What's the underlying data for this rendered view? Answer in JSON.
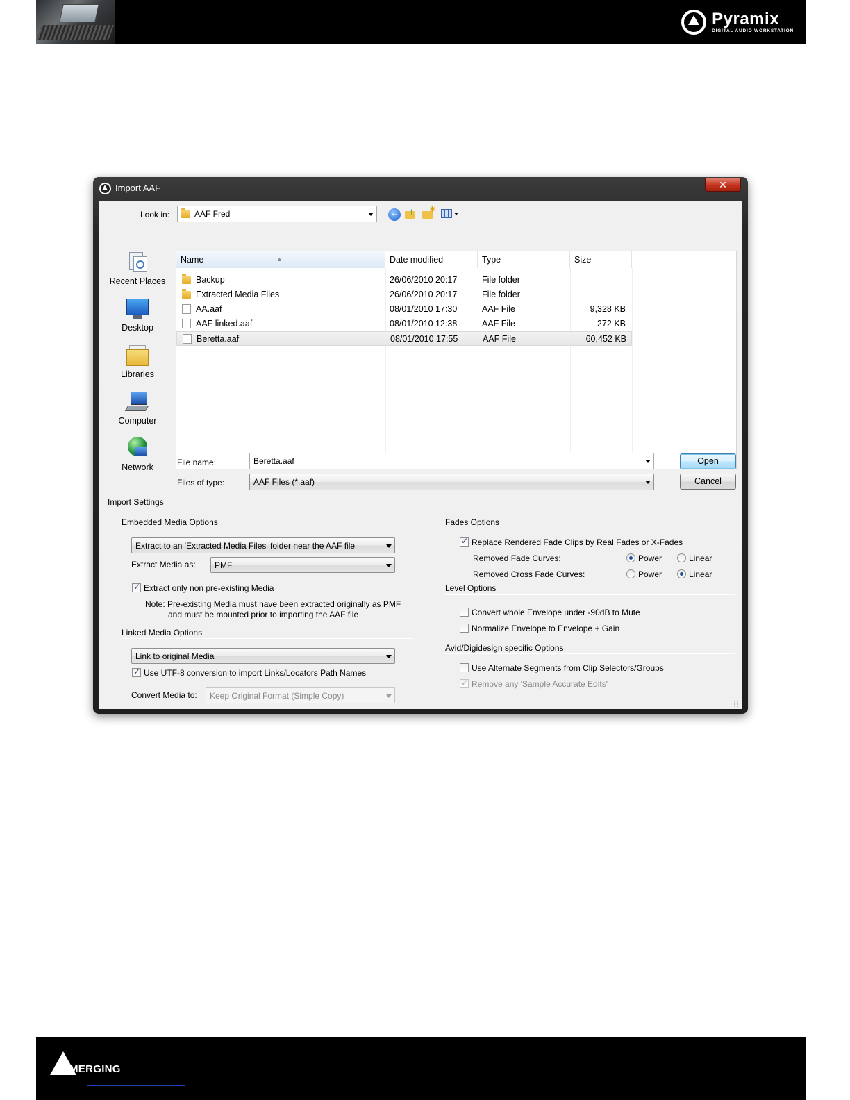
{
  "header": {
    "brand_name": "Pyramix",
    "brand_tagline": "DIGITAL AUDIO WORKSTATION"
  },
  "footer": {
    "company": "MERGING"
  },
  "dialog": {
    "title": "Import AAF",
    "close_label": "✕",
    "look_in_label": "Look in:",
    "look_in_value": "AAF Fred",
    "places": [
      "Recent Places",
      "Desktop",
      "Libraries",
      "Computer",
      "Network"
    ],
    "columns": [
      "Name",
      "Date modified",
      "Type",
      "Size"
    ],
    "files": [
      {
        "name": "Backup",
        "date": "26/06/2010 20:17",
        "type": "File folder",
        "size": "",
        "kind": "folder"
      },
      {
        "name": "Extracted Media Files",
        "date": "26/06/2010 20:17",
        "type": "File folder",
        "size": "",
        "kind": "folder"
      },
      {
        "name": "AA.aaf",
        "date": "08/01/2010 17:30",
        "type": "AAF File",
        "size": "9,328 KB",
        "kind": "file"
      },
      {
        "name": "AAF linked.aaf",
        "date": "08/01/2010 12:38",
        "type": "AAF File",
        "size": "272 KB",
        "kind": "file"
      },
      {
        "name": "Beretta.aaf",
        "date": "08/01/2010 17:55",
        "type": "AAF File",
        "size": "60,452 KB",
        "kind": "file",
        "selected": true
      }
    ],
    "file_name_label": "File name:",
    "file_name_value": "Beretta.aaf",
    "files_of_type_label": "Files of type:",
    "files_of_type_value": "AAF Files (*.aaf)",
    "open_label": "Open",
    "cancel_label": "Cancel"
  },
  "settings": {
    "title": "Import Settings",
    "embedded": {
      "title": "Embedded Media Options",
      "extract_mode": "Extract to an 'Extracted Media Files' folder near the AAF file",
      "extract_as_label": "Extract Media as:",
      "extract_as_value": "PMF",
      "only_non_existing_label": "Extract only non pre-existing Media",
      "only_non_existing_checked": true,
      "note_line1": "Note: Pre-existing Media must have been extracted originally as PMF",
      "note_line2": "and must be mounted prior to importing the AAF file"
    },
    "linked": {
      "title": "Linked Media Options",
      "link_mode": "Link to original Media",
      "utf8_label": "Use UTF-8 conversion to import Links/Locators Path Names",
      "utf8_checked": true,
      "convert_label": "Convert Media to:",
      "convert_value": "Keep Original Format (Simple Copy)"
    },
    "fades": {
      "title": "Fades Options",
      "replace_label": "Replace Rendered Fade Clips by Real Fades or X-Fades",
      "replace_checked": true,
      "removed_fade_label": "Removed Fade Curves:",
      "removed_fade_selected": "Power",
      "removed_cross_label": "Removed Cross Fade Curves:",
      "removed_cross_selected": "Linear",
      "power_label": "Power",
      "linear_label": "Linear"
    },
    "level": {
      "title": "Level Options",
      "mute_label": "Convert whole Envelope under -90dB to Mute",
      "mute_checked": false,
      "normalize_label": "Normalize Envelope to Envelope + Gain",
      "normalize_checked": false
    },
    "avid": {
      "title": "Avid/Digidesign specific Options",
      "alternate_label": "Use Alternate Segments from Clip Selectors/Groups",
      "alternate_checked": false,
      "sample_accurate_label": "Remove any 'Sample Accurate Edits'",
      "sample_accurate_checked": true,
      "sample_accurate_disabled": true
    }
  }
}
